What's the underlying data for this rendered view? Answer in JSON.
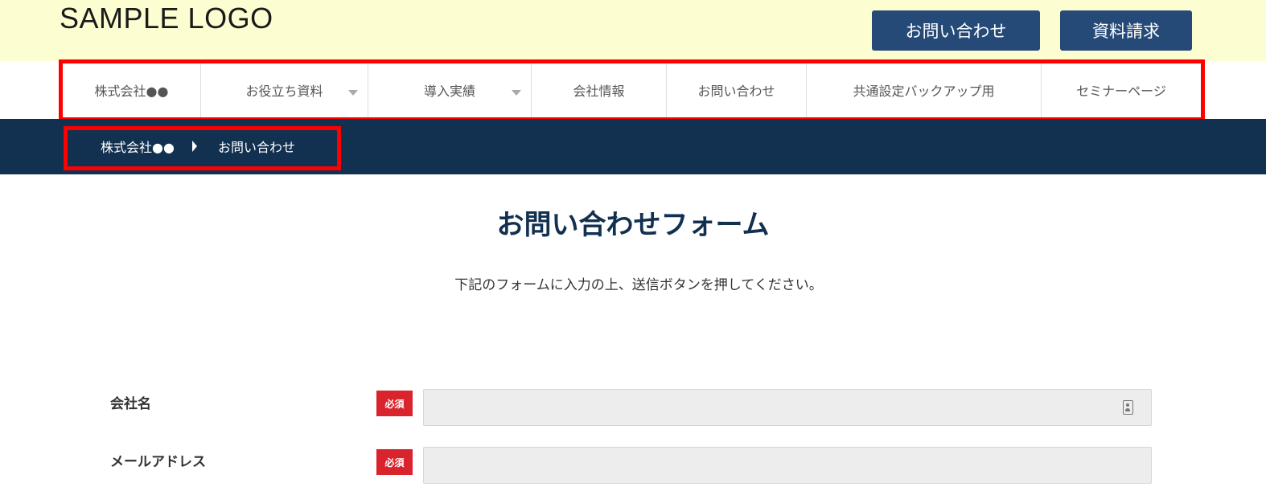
{
  "header": {
    "logo": "SAMPLE LOGO",
    "contact_button": "お問い合わせ",
    "documents_button": "資料請求"
  },
  "nav": {
    "items": [
      {
        "label": "株式会社●●",
        "has_dropdown": false
      },
      {
        "label": "お役立ち資料",
        "has_dropdown": true
      },
      {
        "label": "導入実績",
        "has_dropdown": true
      },
      {
        "label": "会社情報",
        "has_dropdown": false
      },
      {
        "label": "お問い合わせ",
        "has_dropdown": false
      },
      {
        "label": "共通設定バックアップ用",
        "has_dropdown": false
      },
      {
        "label": "セミナーページ",
        "has_dropdown": false
      }
    ]
  },
  "breadcrumb": {
    "home": "株式会社●●",
    "current": "お問い合わせ"
  },
  "main": {
    "title": "お問い合わせフォーム",
    "lead": "下記のフォームに入力の上、送信ボタンを押してください。"
  },
  "form": {
    "fields": [
      {
        "label": "会社名",
        "required_badge": "必須",
        "value": ""
      },
      {
        "label": "メールアドレス",
        "required_badge": "必須",
        "value": ""
      }
    ]
  },
  "colors": {
    "header_bg": "#fdfdd2",
    "button_bg": "#264a78",
    "breadcrumb_bg": "#12304f",
    "title_color": "#12304f",
    "required_badge": "#d9232d",
    "annotation_box": "#ff0000"
  }
}
